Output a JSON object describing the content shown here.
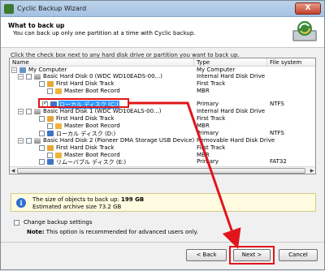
{
  "window": {
    "title": "Cyclic Backup Wizard",
    "close_label": "X"
  },
  "header": {
    "title": "What to back up",
    "subtitle": "You can back up only one partition at a time with Cyclic backup."
  },
  "instruction": "Click the check box next to any hard disk drive or partition you want to back up.",
  "tree": {
    "columns": [
      "Name",
      "Type",
      "File system"
    ],
    "rows": [
      {
        "name": "My Computer",
        "type": "My Computer",
        "fs": ""
      },
      {
        "name": "Basic Hard Disk 0 (WDC WD10EADS-00...)",
        "type": "Internal Hard Disk Drive",
        "fs": ""
      },
      {
        "name": "First Hard Disk Track",
        "type": "First Track",
        "fs": ""
      },
      {
        "name": "Master Boot Record",
        "type": "MBR",
        "fs": ""
      },
      {
        "name": "ローカル ディスク (C:)",
        "type": "Primary",
        "fs": "NTFS"
      },
      {
        "name": "Basic Hard Disk 1 (WDC WD10EALS-00...)",
        "type": "Internal Hard Disk Drive",
        "fs": ""
      },
      {
        "name": "First Hard Disk Track",
        "type": "First Track",
        "fs": ""
      },
      {
        "name": "Master Boot Record",
        "type": "MBR",
        "fs": ""
      },
      {
        "name": "ローカル ディスク (D:)",
        "type": "Primary",
        "fs": "NTFS"
      },
      {
        "name": "Basic Hard Disk 2 (Pioneer DMA Storage USB Device)",
        "type": "Removable Hard Disk Drive",
        "fs": ""
      },
      {
        "name": "First Hard Disk Track",
        "type": "First Track",
        "fs": ""
      },
      {
        "name": "Master Boot Record",
        "type": "MBR",
        "fs": ""
      },
      {
        "name": "リムーバブル ディスク (E:)",
        "type": "Primary",
        "fs": "FAT32"
      }
    ]
  },
  "info": {
    "line1_prefix": "The size of objects to back up:",
    "line1_value": "199 GB",
    "line2": "Estimated archive size 73.2 GB"
  },
  "options": {
    "change_settings_label": "Change backup settings",
    "note_label": "Note:",
    "note_text": "This option is recommended for advanced users only."
  },
  "buttons": {
    "back": "< Back",
    "next": "Next >",
    "cancel": "Cancel"
  },
  "colors": {
    "highlight_red": "#e0161b",
    "selection_blue": "#3399ff"
  }
}
